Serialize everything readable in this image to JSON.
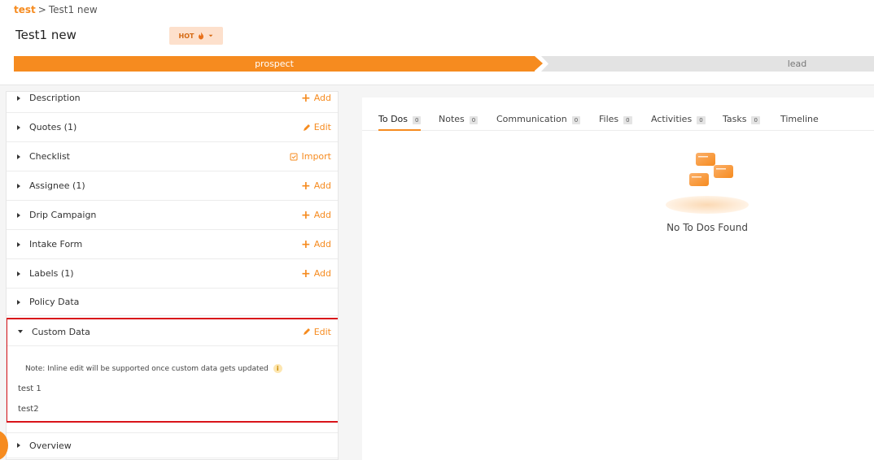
{
  "breadcrumb": {
    "parent": "test",
    "separator": ">",
    "current": "Test1 new"
  },
  "page": {
    "title": "Test1 new"
  },
  "badge": {
    "label": "HOT"
  },
  "pipeline": {
    "stages": [
      {
        "label": "prospect"
      },
      {
        "label": "lead"
      }
    ]
  },
  "sections": {
    "description": {
      "label": "Description",
      "action": "Add"
    },
    "quotes": {
      "label": "Quotes (1)",
      "action": "Edit"
    },
    "checklist": {
      "label": "Checklist",
      "action": "Import"
    },
    "assignee": {
      "label": "Assignee (1)",
      "action": "Add"
    },
    "drip": {
      "label": "Drip Campaign",
      "action": "Add"
    },
    "intake": {
      "label": "Intake Form",
      "action": "Add"
    },
    "labels": {
      "label": "Labels (1)",
      "action": "Add"
    },
    "policy": {
      "label": "Policy Data"
    },
    "custom": {
      "label": "Custom Data",
      "action": "Edit",
      "note": "Note: Inline edit will be supported once custom data gets updated",
      "values": [
        "test 1",
        "test2"
      ]
    },
    "overview": {
      "label": "Overview"
    }
  },
  "tabs": [
    {
      "label": "To Dos",
      "count": "0"
    },
    {
      "label": "Notes",
      "count": "0"
    },
    {
      "label": "Communication",
      "count": "0"
    },
    {
      "label": "Files",
      "count": "0"
    },
    {
      "label": "Activities",
      "count": "0"
    },
    {
      "label": "Tasks",
      "count": "0"
    },
    {
      "label": "Timeline"
    }
  ],
  "empty_state": {
    "message": "No To Dos Found"
  },
  "colors": {
    "accent": "#f68b1f",
    "highlight_border": "#d9141a",
    "stage_inactive": "#e3e3e3"
  },
  "icons": {
    "badge": "fire-icon",
    "add": "plus-icon",
    "edit": "pencil-icon",
    "import": "checklist-import-icon",
    "info": "info-icon",
    "caret": "caret-icon"
  }
}
